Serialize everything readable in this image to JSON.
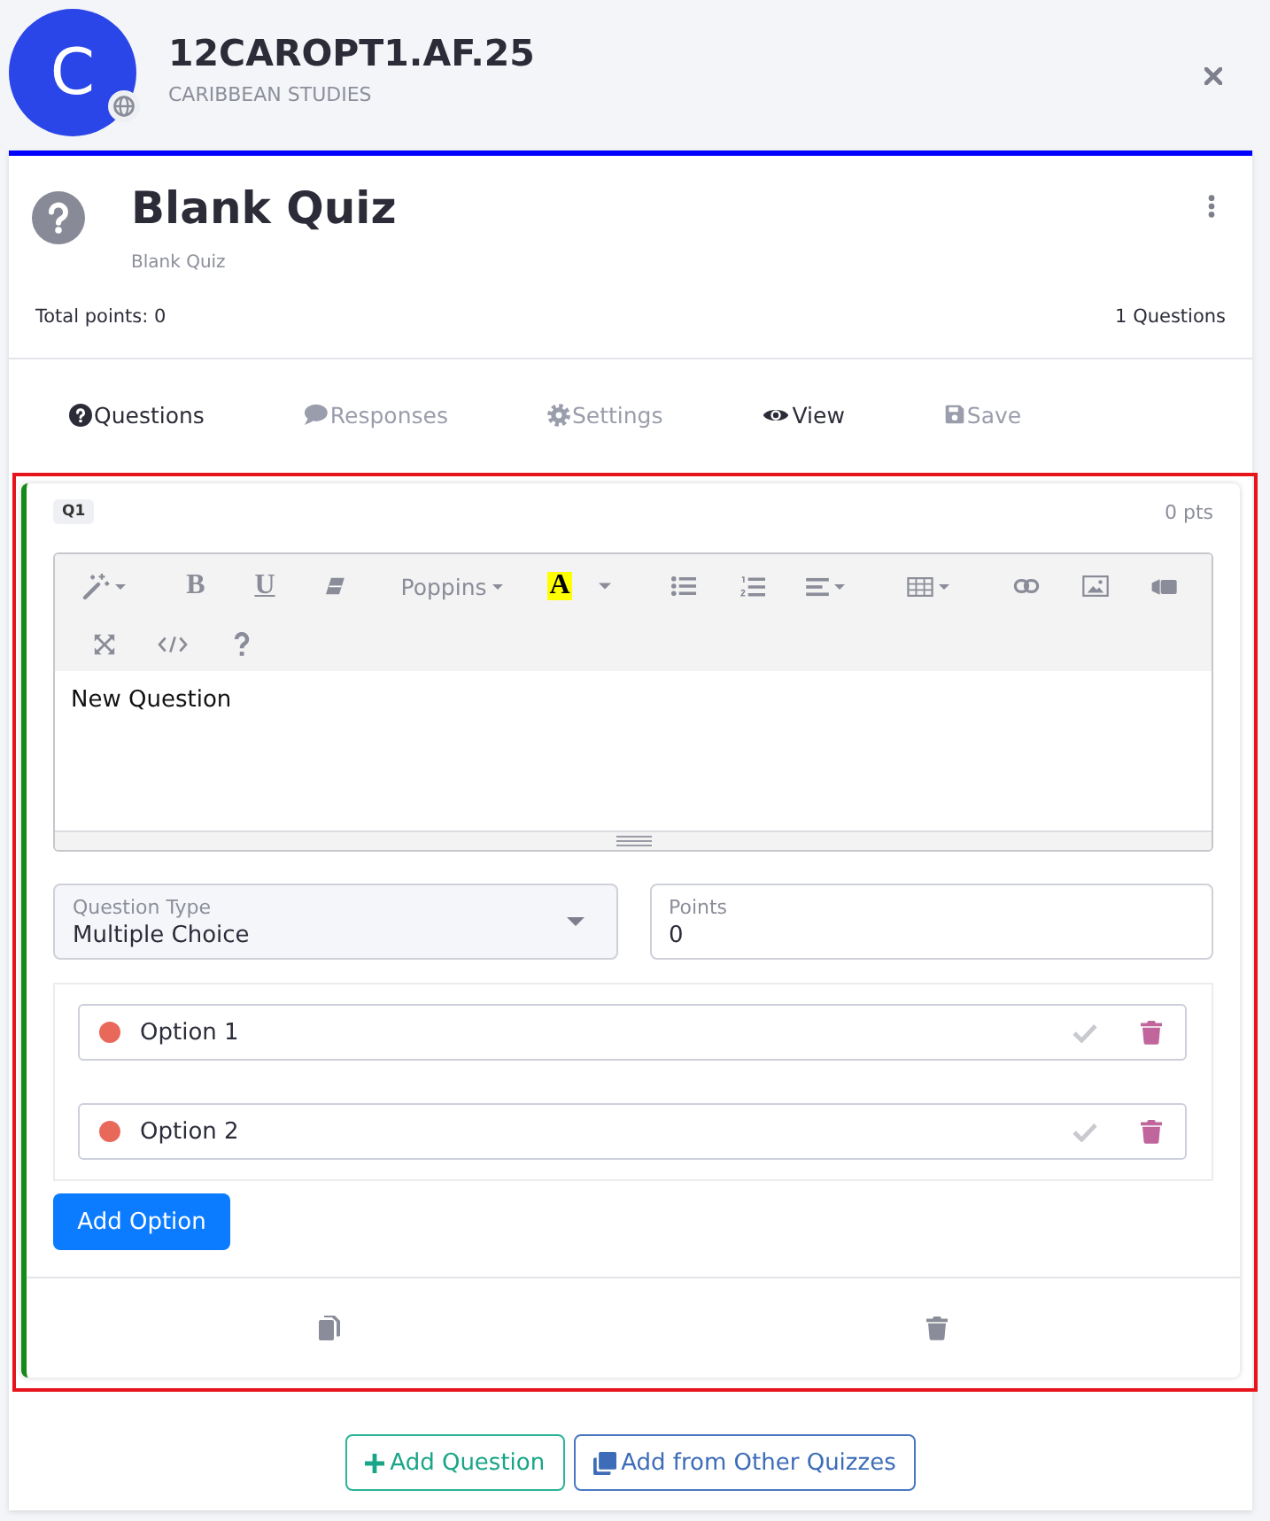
{
  "header": {
    "avatar_letter": "C",
    "title": "12CAROPT1.AF.25",
    "subtitle": "CARIBBEAN STUDIES"
  },
  "quiz": {
    "title": "Blank Quiz",
    "description": "Blank Quiz",
    "total_points": "Total points: 0",
    "question_count": "1 Questions"
  },
  "tabs": [
    {
      "label": "Questions",
      "selected": true
    },
    {
      "label": "Responses",
      "selected": false
    },
    {
      "label": "Settings",
      "selected": false
    }
  ],
  "actions": [
    {
      "label": "View",
      "disabled": false
    },
    {
      "label": "Save",
      "disabled": true
    }
  ],
  "question": {
    "badge": "Q1",
    "points_label": "0 pts",
    "toolbar": [
      [
        {
          "kind": "style"
        }
      ],
      [
        {
          "kind": "bold",
          "label": "B"
        },
        {
          "kind": "underline",
          "label": "U"
        },
        {
          "kind": "eraser"
        }
      ],
      [
        {
          "kind": "font",
          "label": "Poppins"
        }
      ],
      [
        {
          "kind": "color",
          "label": "A"
        },
        {
          "kind": "caret"
        }
      ],
      [
        {
          "kind": "bullets"
        },
        {
          "kind": "numbers"
        },
        {
          "kind": "align"
        }
      ],
      [
        {
          "kind": "table"
        }
      ],
      [
        {
          "kind": "link"
        },
        {
          "kind": "image"
        },
        {
          "kind": "video"
        }
      ],
      [
        {
          "kind": "fullscreen"
        },
        {
          "kind": "code"
        },
        {
          "kind": "help"
        }
      ]
    ],
    "text": "New Question",
    "type_field": {
      "label": "Question Type",
      "value": "Multiple Choice"
    },
    "points_field": {
      "label": "Points",
      "value": "0"
    },
    "options": [
      {
        "text": "Option 1",
        "correct": false
      },
      {
        "text": "Option 2",
        "correct": false
      }
    ],
    "add_option": "Add Option"
  },
  "footer_buttons": [
    {
      "kind": "add",
      "label": "Add Question"
    },
    {
      "kind": "import",
      "label": "Add from Other Quizzes"
    }
  ]
}
